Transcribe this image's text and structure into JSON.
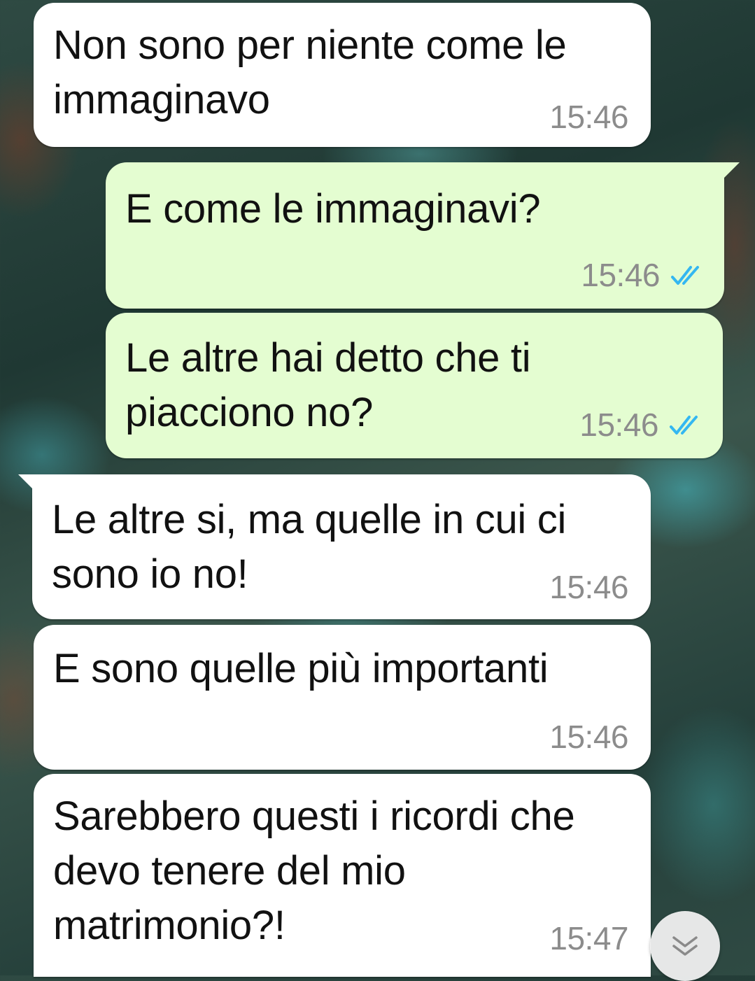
{
  "messages": [
    {
      "direction": "incoming",
      "text": "Non sono per niente come le immaginavo",
      "time": "15:46"
    },
    {
      "direction": "outgoing",
      "text": "E come le immaginavi?",
      "time": "15:46",
      "status": "read"
    },
    {
      "direction": "outgoing",
      "text": "Le altre hai detto che ti piacciono no?",
      "time": "15:46",
      "status": "read"
    },
    {
      "direction": "incoming",
      "text": "Le altre si, ma quelle in cui ci sono io no!",
      "time": "15:46"
    },
    {
      "direction": "incoming",
      "text": "E sono quelle più importanti",
      "time": "15:46"
    },
    {
      "direction": "incoming",
      "text": "Sarebbero questi i ricordi che devo tenere del mio matrimonio?!",
      "time": "15:47"
    }
  ],
  "colors": {
    "incoming_bubble": "#ffffff",
    "outgoing_bubble": "#e4fdd1",
    "read_ticks": "#34b7f1",
    "timestamp": "#8c8c8c"
  },
  "icons": {
    "read_status": "double-check-icon",
    "scroll_down": "chevron-double-down-icon"
  }
}
